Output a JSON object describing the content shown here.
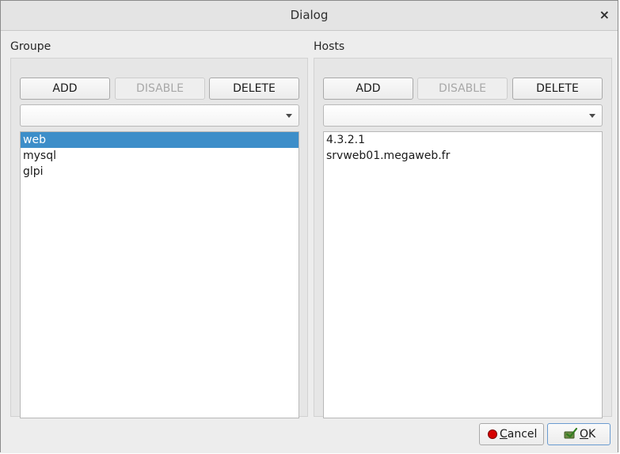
{
  "window": {
    "title": "Dialog",
    "close_glyph": "×"
  },
  "groupe": {
    "label": "Groupe",
    "add_label": "ADD",
    "disable_label": "DISABLE",
    "delete_label": "DELETE",
    "combo_value": "",
    "items": [
      {
        "label": "web",
        "selected": true
      },
      {
        "label": "mysql",
        "selected": false
      },
      {
        "label": "glpi",
        "selected": false
      }
    ]
  },
  "hosts": {
    "label": "Hosts",
    "add_label": "ADD",
    "disable_label": "DISABLE",
    "delete_label": "DELETE",
    "combo_value": "",
    "items": [
      {
        "label": "4.3.2.1"
      },
      {
        "label": "srvweb01.megaweb.fr"
      }
    ]
  },
  "footer": {
    "cancel_first": "C",
    "cancel_rest": "ancel",
    "ok_first": "O",
    "ok_rest": "K",
    "cancel_icon": "stop-icon",
    "ok_icon": "check-icon"
  },
  "colors": {
    "selection": "#3d8ec9",
    "stop_red": "#d50000"
  }
}
